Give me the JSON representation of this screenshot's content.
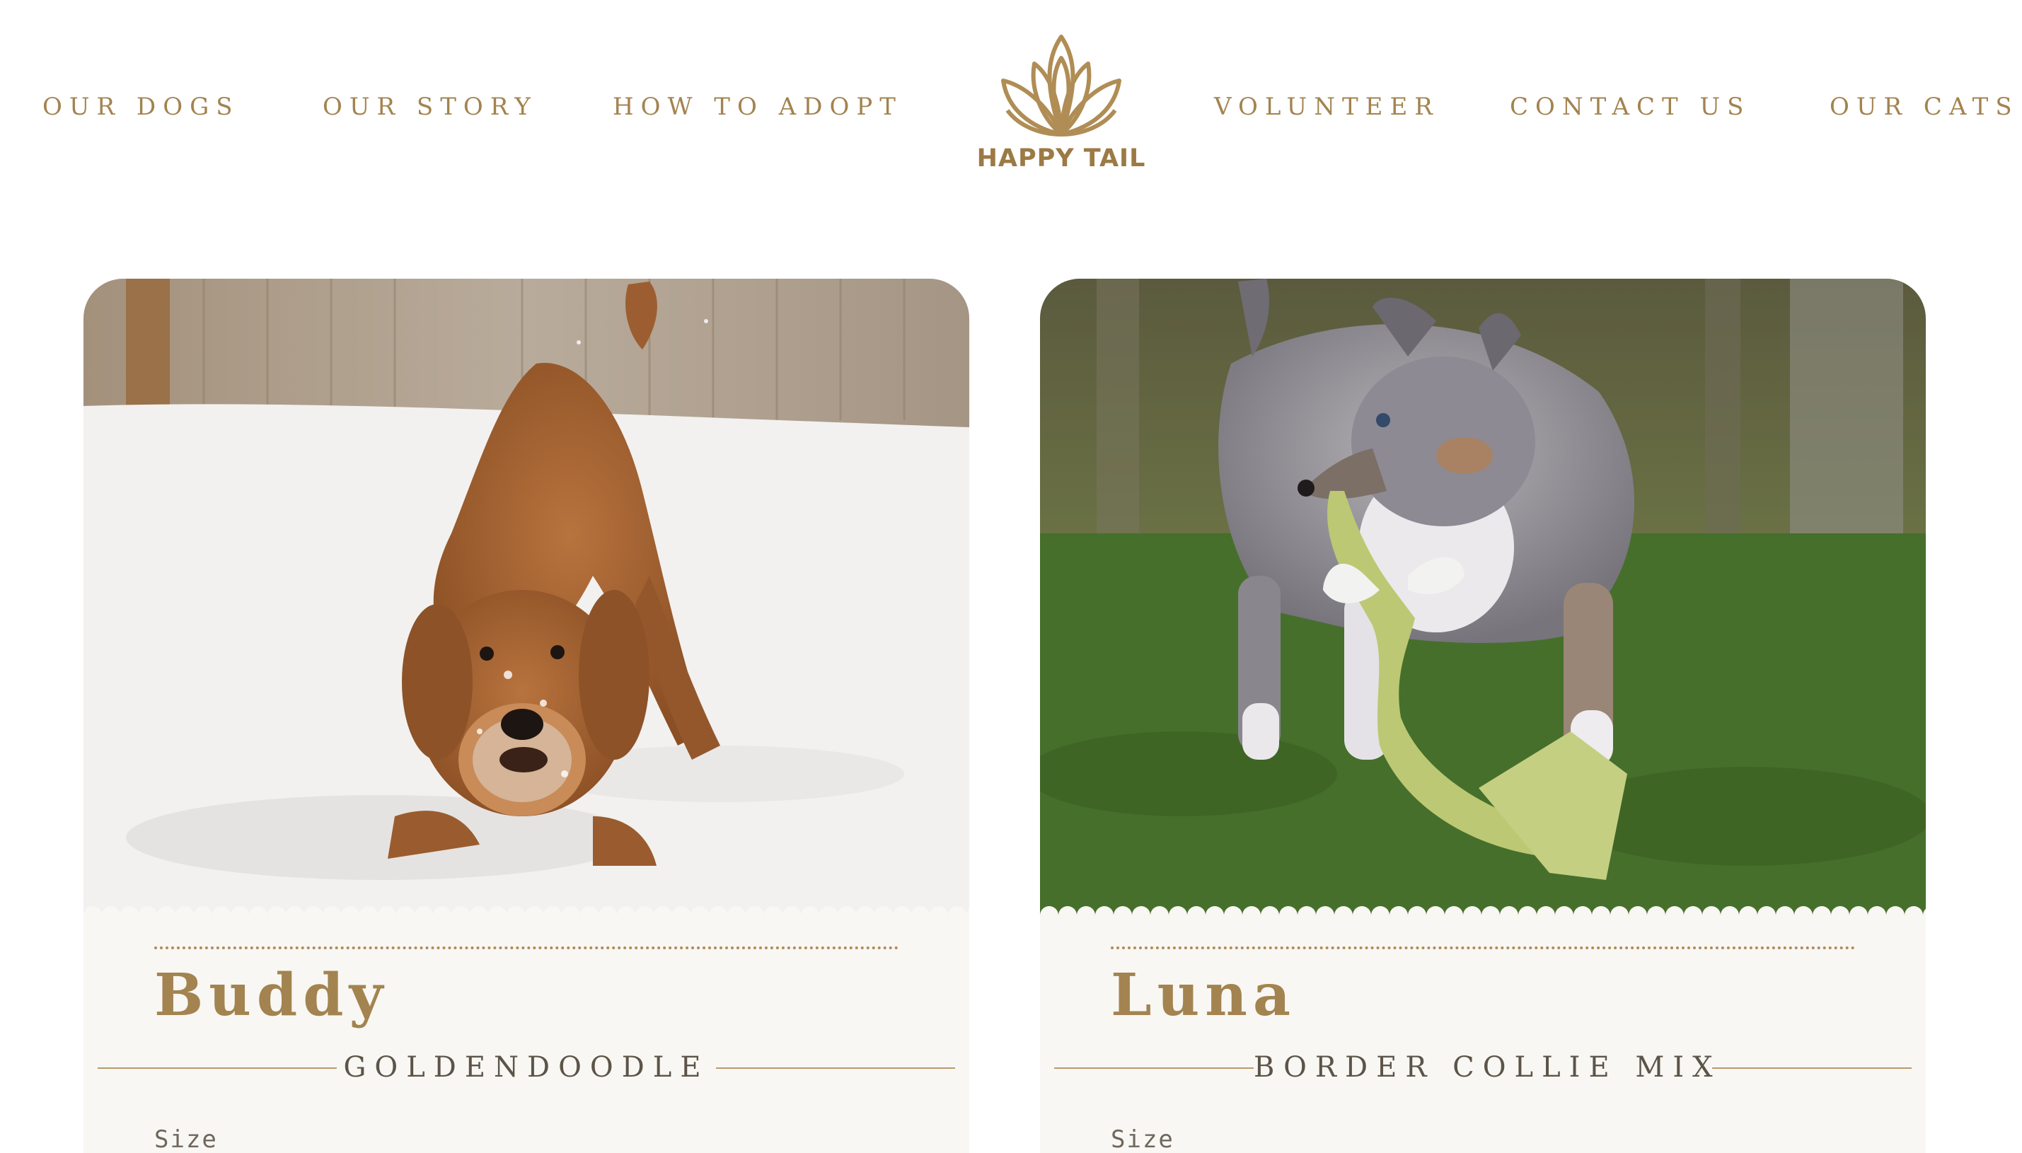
{
  "nav": {
    "left_links": [
      "OUR DOGS",
      "OUR STORY",
      "HOW TO ADOPT"
    ],
    "right_links": [
      "VOLUNTEER",
      "CONTACT US",
      "OUR CATS"
    ],
    "logo_text": "HAPPY TAIL"
  },
  "colors": {
    "brand_gold": "#a3834f",
    "card_background": "#f8f7f3",
    "breed_text": "#5c5448"
  },
  "cards": [
    {
      "name": "Buddy",
      "breed": "GOLDENDOODLE",
      "size_label": "Size",
      "photo": "goldendoodle-in-snow-photo"
    },
    {
      "name": "Luna",
      "breed": "BORDER COLLIE MIX",
      "size_label": "Size",
      "photo": "puppy-with-rope-toy-on-grass-photo"
    }
  ]
}
